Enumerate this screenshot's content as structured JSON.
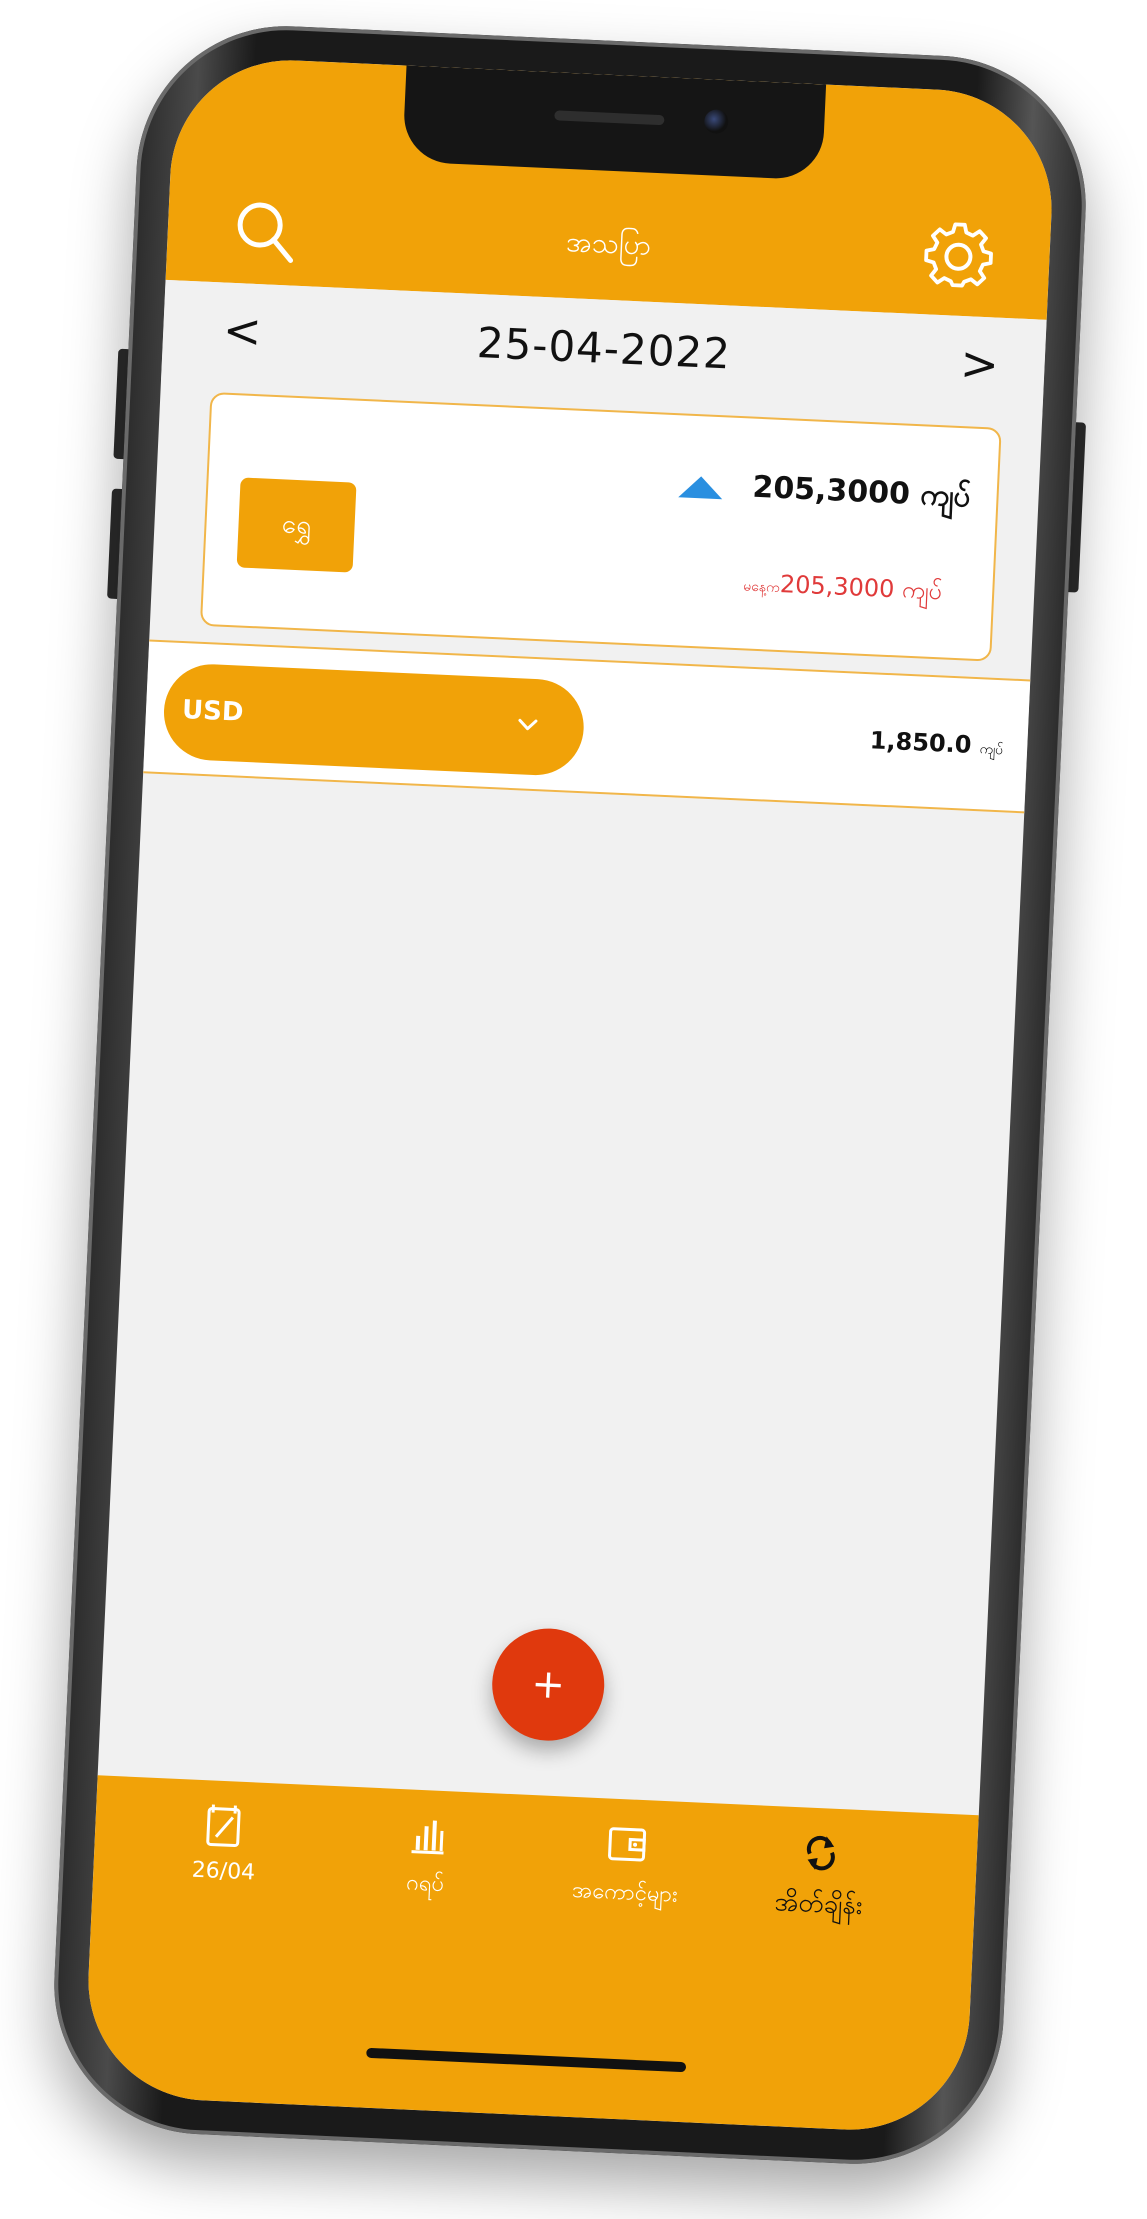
{
  "header": {
    "title": "အသပြာ"
  },
  "datebar": {
    "prev_glyph": "<",
    "date": "25-04-2022",
    "next_glyph": ">"
  },
  "gold_card": {
    "badge": "ရွှေ",
    "price": "205,3000 ကျပ်",
    "prev_label": "မနေ့က",
    "prev_price": "205,3000 ကျပ်",
    "trend_color": "#2a8fe0",
    "prev_color": "#e03a3a"
  },
  "currency": {
    "code": "USD",
    "rate": "1,850.0",
    "rate_unit": "ကျပ်"
  },
  "fab": {
    "label": "+"
  },
  "bottom_nav": [
    {
      "icon": "notepad-icon",
      "label": "26/04"
    },
    {
      "icon": "bar-chart-icon",
      "label": "ဂရပ်"
    },
    {
      "icon": "wallet-icon",
      "label": "အကောင့်များ"
    },
    {
      "icon": "refresh-icon",
      "label": "အိတ်ချိန်း"
    }
  ],
  "colors": {
    "accent": "#f1a208",
    "fab": "#e0390d",
    "background": "#f1f1f1"
  }
}
